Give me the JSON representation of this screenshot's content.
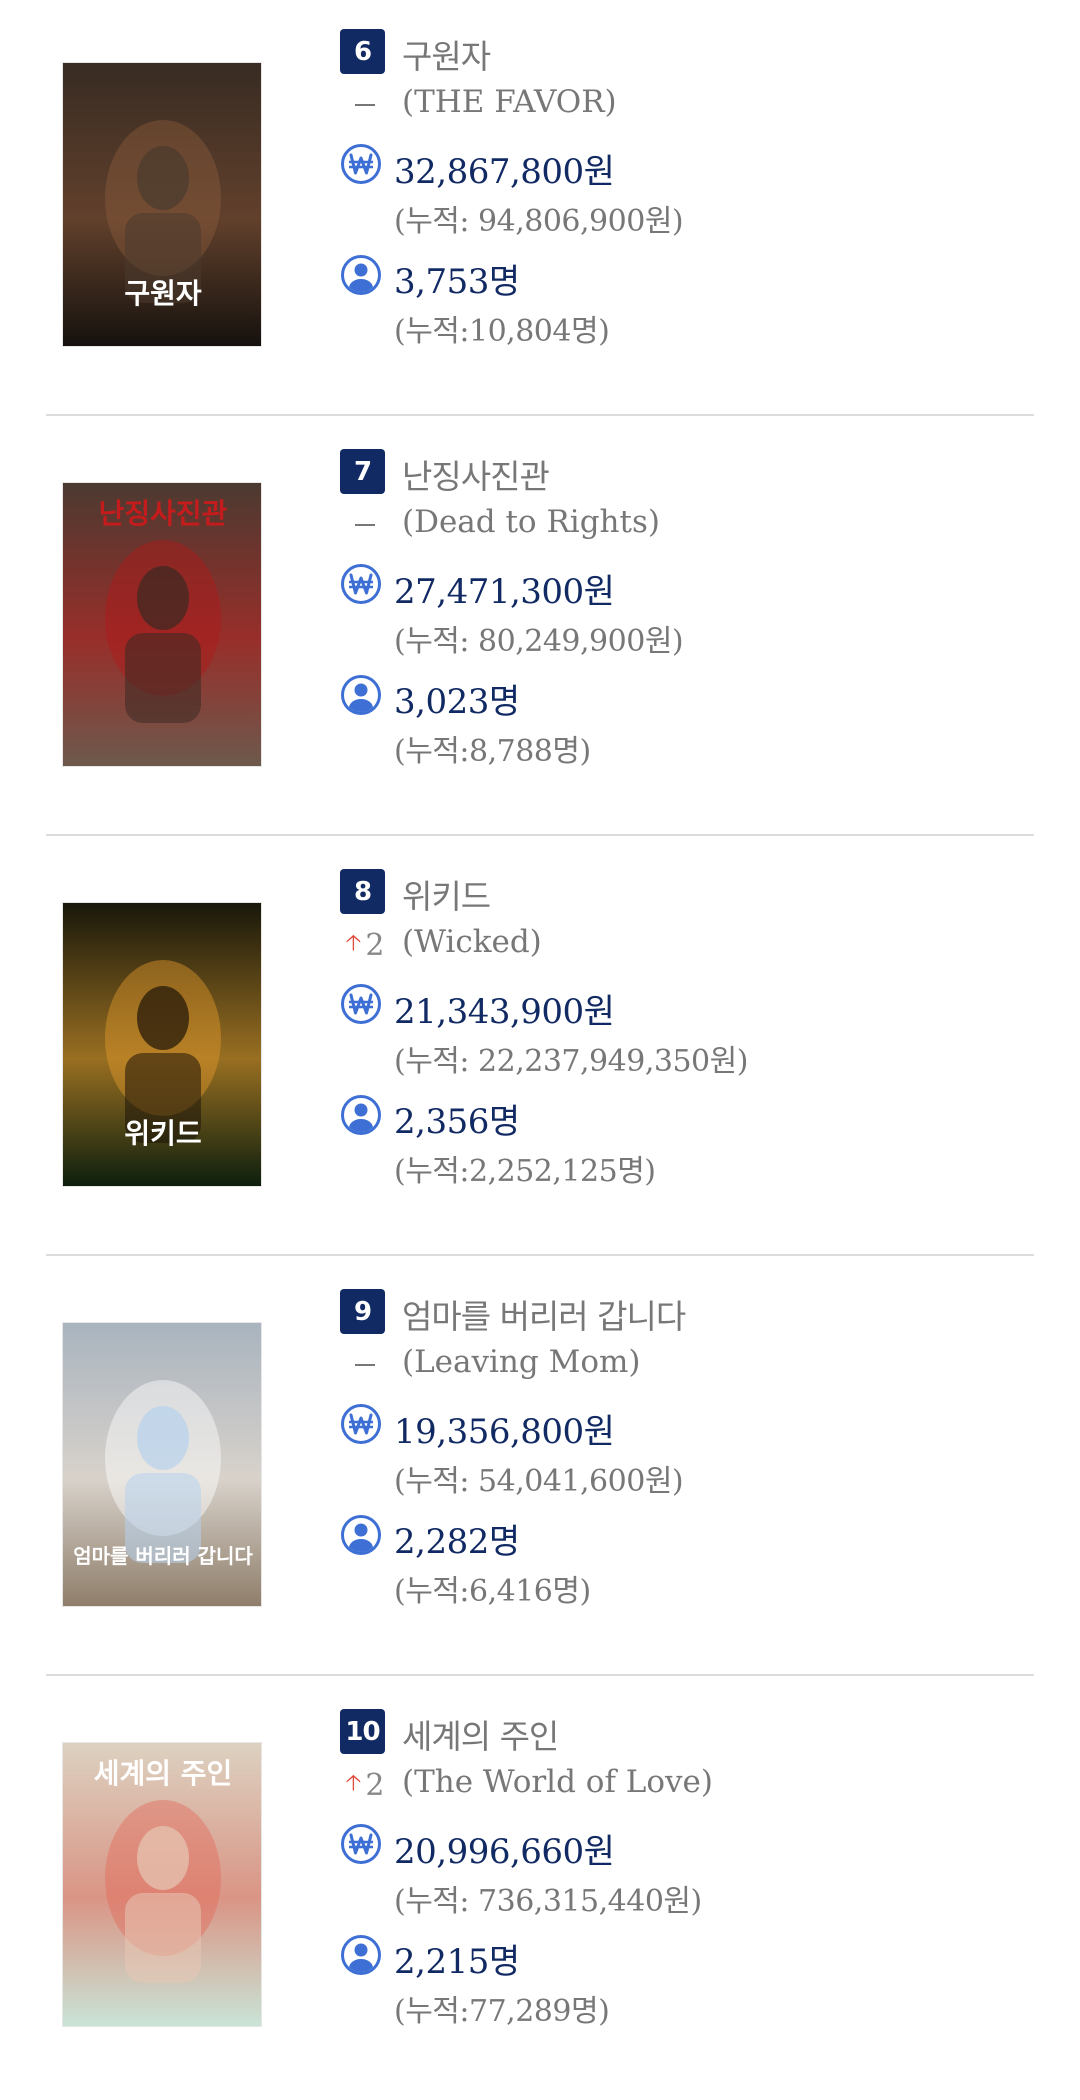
{
  "movies": [
    {
      "rank": "6",
      "title": "구원자",
      "eng_title": "(THE FAVOR)",
      "change": {
        "type": "none",
        "value": ""
      },
      "revenue": "32,867,800원",
      "revenue_cum": "(누적: 94,806,900원)",
      "audience": "3,753명",
      "audience_cum": "(누적:10,804명)",
      "poster": {
        "text": "구원자",
        "bg_top": "#4a3a2e",
        "bg_bottom": "#16120f",
        "accent": "#8a5a3c"
      }
    },
    {
      "rank": "7",
      "title": "난징사진관",
      "eng_title": "(Dead to Rights)",
      "change": {
        "type": "none",
        "value": ""
      },
      "revenue": "27,471,300원",
      "revenue_cum": "(누적: 80,249,900원)",
      "audience": "3,023명",
      "audience_cum": "(누적:8,788명)",
      "poster": {
        "text": "난징사진관",
        "bg_top": "#3a2a22",
        "bg_bottom": "#6d5a4c",
        "accent": "#b01818"
      }
    },
    {
      "rank": "8",
      "title": "위키드",
      "eng_title": "(Wicked)",
      "change": {
        "type": "up",
        "value": "2"
      },
      "revenue": "21,343,900원",
      "revenue_cum": "(누적: 22,237,949,350원)",
      "audience": "2,356명",
      "audience_cum": "(누적:2,252,125명)",
      "poster": {
        "text": "위키드",
        "bg_top": "#1e1409",
        "bg_bottom": "#0d1f0e",
        "accent": "#e39a2c"
      }
    },
    {
      "rank": "9",
      "title": "엄마를 버리러 갑니다",
      "eng_title": "(Leaving Mom)",
      "change": {
        "type": "none",
        "value": ""
      },
      "revenue": "19,356,800원",
      "revenue_cum": "(누적: 54,041,600원)",
      "audience": "2,282명",
      "audience_cum": "(누적:6,416명)",
      "poster": {
        "text": "엄마를 버리러 갑니다",
        "bg_top": "#b7d1ec",
        "bg_bottom": "#8f7e6b",
        "accent": "#ffffff"
      }
    },
    {
      "rank": "10",
      "title": "세계의 주인",
      "eng_title": "(The World of Love)",
      "change": {
        "type": "up",
        "value": "2"
      },
      "revenue": "20,996,660원",
      "revenue_cum": "(누적: 736,315,440원)",
      "audience": "2,215명",
      "audience_cum": "(누적:77,289명)",
      "poster": {
        "text": "세계의 주인",
        "bg_top": "#e7c7b5",
        "bg_bottom": "#c9e4d6",
        "accent": "#e36a5a"
      }
    }
  ],
  "icons": {
    "revenue": "won-icon",
    "audience": "person-icon",
    "increase": "up-arrow-icon",
    "no_change": "dash-icon"
  },
  "colors": {
    "rank_badge": "#112a63",
    "value_text": "#112a63",
    "icon": "#3d6fd4",
    "up_arrow": "#e24b3b"
  }
}
